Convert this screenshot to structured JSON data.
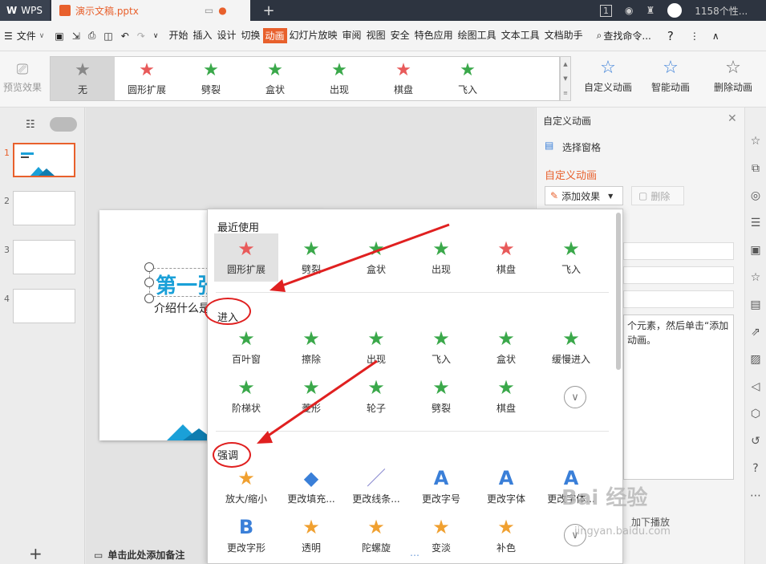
{
  "titlebar": {
    "app_name": "WPS",
    "doc_name": "演示文稿.pptx",
    "badge": "1",
    "user": "1158个性..."
  },
  "menu": {
    "file": "文件",
    "items": [
      "开始",
      "插入",
      "设计",
      "切换",
      "动画",
      "幻灯片放映",
      "审阅",
      "视图",
      "安全",
      "特色应用",
      "绘图工具",
      "文本工具",
      "文档助手"
    ],
    "active": "动画",
    "search": "查找命令..."
  },
  "ribbon": {
    "preview": "预览效果",
    "gallery": [
      {
        "label": "无",
        "color": "#888888",
        "sel": true
      },
      {
        "label": "圆形扩展",
        "color": "#e85a5a"
      },
      {
        "label": "劈裂",
        "color": "#3aa84a"
      },
      {
        "label": "盒状",
        "color": "#3aa84a"
      },
      {
        "label": "出现",
        "color": "#3aa84a"
      },
      {
        "label": "棋盘",
        "color": "#e85a5a"
      },
      {
        "label": "飞入",
        "color": "#3aa84a"
      }
    ],
    "custom": "自定义动画",
    "smart": "智能动画",
    "delete": "删除动画"
  },
  "thumbs": [
    "1",
    "2",
    "3",
    "4"
  ],
  "slide": {
    "title": "第一张",
    "subtitle": "介绍什么是"
  },
  "notes": "单击此处添加备注",
  "pane": {
    "header": "自定义动画",
    "select": "选择窗格",
    "section": "自定义动画",
    "add": "添加效果",
    "remove": "删除",
    "hint": "个元素，然后单击“添加动画。",
    "play": "加下播放"
  },
  "popup": {
    "recent_title": "最近使用",
    "recent": [
      {
        "label": "圆形扩展",
        "color": "#e85a5a"
      },
      {
        "label": "劈裂",
        "color": "#3aa84a"
      },
      {
        "label": "盒状",
        "color": "#3aa84a"
      },
      {
        "label": "出现",
        "color": "#3aa84a"
      },
      {
        "label": "棋盘",
        "color": "#e85a5a"
      },
      {
        "label": "飞入",
        "color": "#3aa84a"
      }
    ],
    "enter_title": "进入",
    "enter": [
      {
        "label": "百叶窗",
        "color": "#3aa84a"
      },
      {
        "label": "擦除",
        "color": "#3aa84a"
      },
      {
        "label": "出现",
        "color": "#3aa84a"
      },
      {
        "label": "飞入",
        "color": "#3aa84a"
      },
      {
        "label": "盒状",
        "color": "#3aa84a"
      },
      {
        "label": "缓慢进入",
        "color": "#3aa84a"
      },
      {
        "label": "阶梯状",
        "color": "#3aa84a"
      },
      {
        "label": "菱形",
        "color": "#3aa84a"
      },
      {
        "label": "轮子",
        "color": "#3aa84a"
      },
      {
        "label": "劈裂",
        "color": "#3aa84a"
      },
      {
        "label": "棋盘",
        "color": "#3aa84a"
      }
    ],
    "emph_title": "强调",
    "emph": [
      {
        "label": "放大/缩小",
        "icon": "★",
        "color": "#f0a030"
      },
      {
        "label": "更改填充...",
        "icon": "◆",
        "color": "#3a7fd8"
      },
      {
        "label": "更改线条...",
        "icon": "／",
        "color": "#8a8ad0"
      },
      {
        "label": "更改字号",
        "icon": "A",
        "color": "#3a7fd8"
      },
      {
        "label": "更改字体",
        "icon": "A",
        "color": "#3a7fd8"
      },
      {
        "label": "更改字体...",
        "icon": "A",
        "color": "#3a7fd8"
      },
      {
        "label": "更改字形",
        "icon": "B",
        "color": "#3a7fd8"
      },
      {
        "label": "透明",
        "icon": "★",
        "color": "#f0a030"
      },
      {
        "label": "陀螺旋",
        "icon": "★",
        "color": "#f0a030"
      },
      {
        "label": "变淡",
        "icon": "★",
        "color": "#f0a030"
      },
      {
        "label": "补色",
        "icon": "★",
        "color": "#f0a030"
      }
    ]
  },
  "watermark": {
    "main": "Bai 经验",
    "url": "jingyan.baidu.com"
  }
}
